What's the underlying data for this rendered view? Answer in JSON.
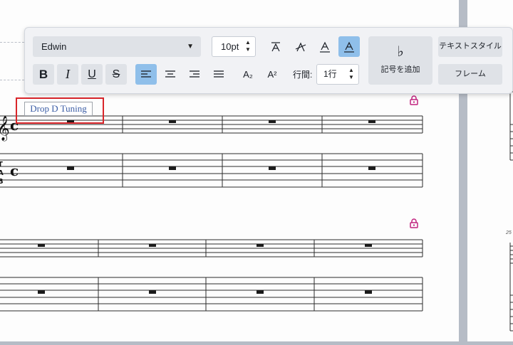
{
  "toolbar": {
    "font_family": "Edwin",
    "font_size": "10pt",
    "line_spacing_label": "行間:",
    "line_spacing_value": "1行",
    "add_symbol_label": "記号を追加",
    "text_style_label": "テキストスタイル",
    "frame_label": "フレーム",
    "bold_label": "B",
    "italic_label": "I",
    "underline_label": "U",
    "strike_label": "S",
    "subscript_label": "A₂",
    "superscript_label": "A²"
  },
  "score": {
    "staff_text": "Drop D Tuning",
    "measure_number": "25",
    "lock_color": "#c2237f"
  },
  "colors": {
    "active_button": "#8fbfea",
    "selection": "#d9252a",
    "staff_text": "#3c5ea6"
  }
}
